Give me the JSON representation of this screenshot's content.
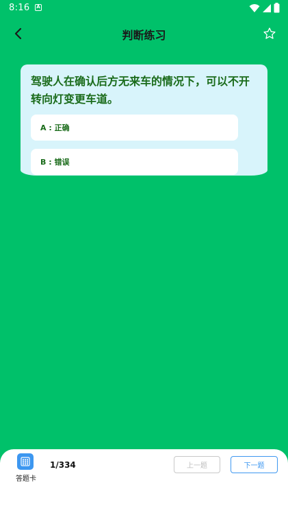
{
  "status_bar": {
    "time": "8:16",
    "app_icon": "A"
  },
  "header": {
    "title": "判断练习"
  },
  "question": {
    "text": "驾驶人在确认后方无来车的情况下，可以不开转向灯变更车道。",
    "options": [
      {
        "label": "A : 正确"
      },
      {
        "label": "B : 错误"
      }
    ]
  },
  "footer": {
    "answer_card_label": "答题卡",
    "progress": "1/334",
    "prev_label": "上一题",
    "next_label": "下一题"
  },
  "colors": {
    "background": "#00c16a",
    "card": "#d8f4fb",
    "question_text": "#1a6b1a",
    "accent": "#3d97f0"
  },
  "icons": {
    "back": "back-arrow-icon",
    "favorite": "star-outline-icon",
    "answer_card": "grid-card-icon"
  }
}
